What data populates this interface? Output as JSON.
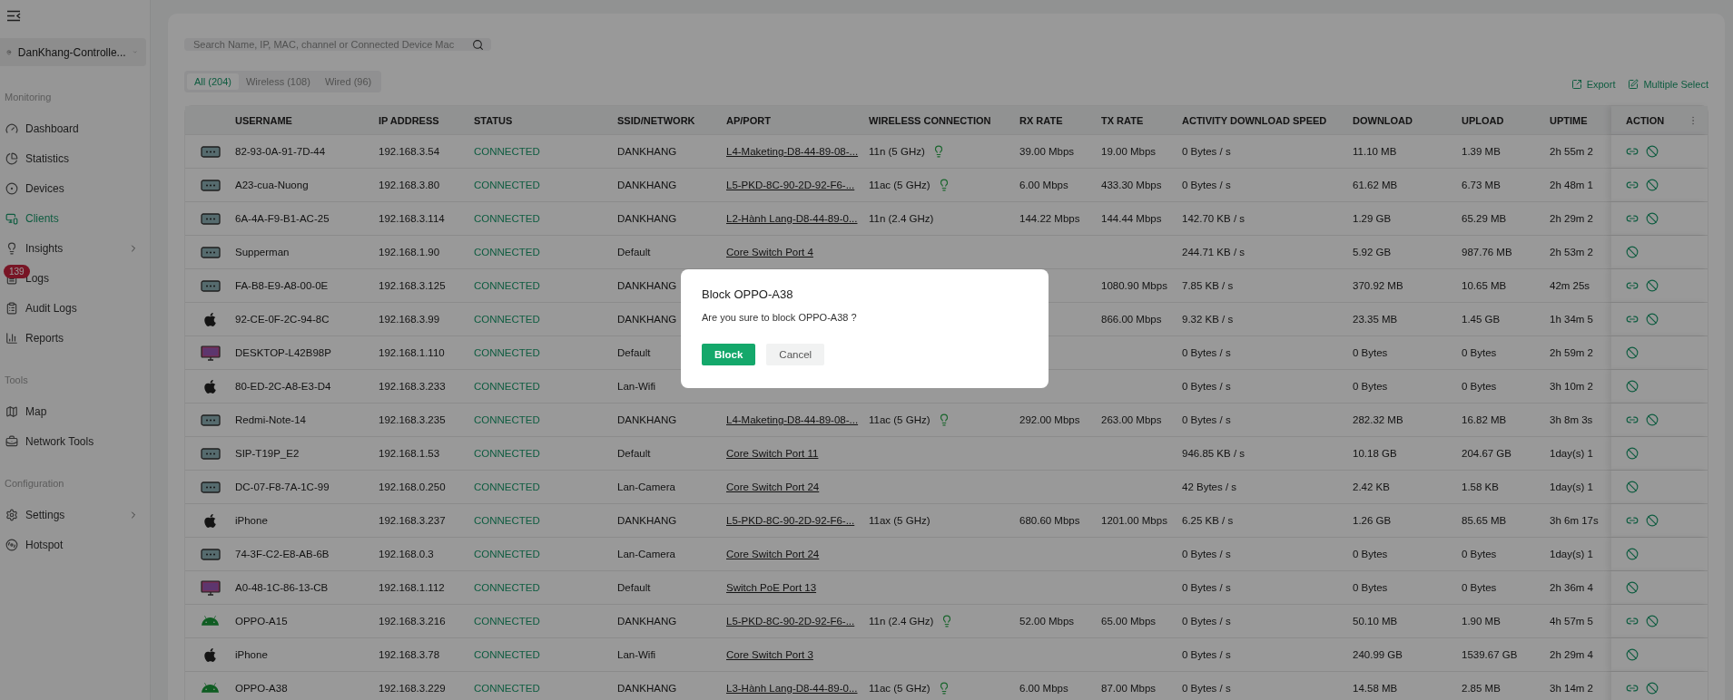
{
  "sidebar": {
    "site": "DanKhang-Controlle...",
    "sections": [
      {
        "title": "Monitoring",
        "items": [
          {
            "label": "Dashboard",
            "selected": false
          },
          {
            "label": "Statistics",
            "selected": false
          },
          {
            "label": "Devices",
            "selected": false
          },
          {
            "label": "Clients",
            "selected": true
          },
          {
            "label": "Insights",
            "selected": false,
            "submenu": true
          },
          {
            "label": "Logs",
            "selected": false,
            "badge": "139"
          },
          {
            "label": "Audit Logs",
            "selected": false
          },
          {
            "label": "Reports",
            "selected": false
          }
        ]
      },
      {
        "title": "Tools",
        "items": [
          {
            "label": "Map",
            "selected": false
          },
          {
            "label": "Network Tools",
            "selected": false
          }
        ]
      },
      {
        "title": "Configuration",
        "items": [
          {
            "label": "Settings",
            "selected": false,
            "submenu": true
          },
          {
            "label": "Hotspot",
            "selected": false
          }
        ]
      }
    ]
  },
  "search": {
    "placeholder": "Search Name, IP, MAC, channel or Connected Device Mac"
  },
  "tabs": [
    {
      "label": "All (204)",
      "selected": true
    },
    {
      "label": "Wireless (108)",
      "selected": false
    },
    {
      "label": "Wired (96)",
      "selected": false
    }
  ],
  "toolbar": [
    "Export",
    "Multiple Select"
  ],
  "table": {
    "columns": [
      "USERNAME",
      "IP ADDRESS",
      "STATUS",
      "SSID/NETWORK",
      "AP/PORT",
      "WIRELESS CONNECTION",
      "RX RATE",
      "TX RATE",
      "ACTIVITY DOWNLOAD SPEED",
      "DOWNLOAD",
      "UPLOAD",
      "UPTIME",
      "ACTION"
    ],
    "rows": [
      {
        "kind": "generic",
        "username": "82-93-0A-91-7D-44",
        "ip": "192.168.3.54",
        "status": "CONNECTED",
        "ssid": "DANKHANG",
        "ap_port": "L4-Maketing-D8-44-89-08-...",
        "wireless": "11n (5 GHz)",
        "bulb": true,
        "rx": "39.00 Mbps",
        "tx": "19.00 Mbps",
        "activity": "0 Bytes / s",
        "download": "11.10 MB",
        "upload": "1.39 MB",
        "uptime": "2h 55m 2",
        "linkable": true
      },
      {
        "kind": "generic",
        "username": "A23-cua-Nuong",
        "ip": "192.168.3.80",
        "status": "CONNECTED",
        "ssid": "DANKHANG",
        "ap_port": "L5-PKD-8C-90-2D-92-F6-...",
        "wireless": "11ac (5 GHz)",
        "bulb": true,
        "rx": "6.00 Mbps",
        "tx": "433.30 Mbps",
        "activity": "0 Bytes / s",
        "download": "61.62 MB",
        "upload": "6.73 MB",
        "uptime": "2h 48m 1",
        "linkable": true
      },
      {
        "kind": "generic",
        "username": "6A-4A-F9-B1-AC-25",
        "ip": "192.168.3.114",
        "status": "CONNECTED",
        "ssid": "DANKHANG",
        "ap_port": "L2-Hành Lang-D8-44-89-0...",
        "wireless": "11n (2.4 GHz)",
        "bulb": false,
        "rx": "144.22 Mbps",
        "tx": "144.44 Mbps",
        "activity": "142.70 KB / s",
        "download": "1.29 GB",
        "upload": "65.29 MB",
        "uptime": "2h 29m 2",
        "linkable": true
      },
      {
        "kind": "generic",
        "username": "Supperman",
        "ip": "192.168.1.90",
        "status": "CONNECTED",
        "ssid": "Default",
        "ap_port": "Core Switch Port 4",
        "activity": "244.71 KB / s",
        "download": "5.92 GB",
        "upload": "987.76 MB",
        "uptime": "2h 53m 2",
        "linkable": false
      },
      {
        "kind": "generic",
        "username": "FA-B8-E9-A8-00-0E",
        "ip": "192.168.3.125",
        "status": "CONNECTED",
        "ssid": "DANKHANG",
        "tx": "1080.90 Mbps",
        "activity": "7.85 KB / s",
        "download": "370.92 MB",
        "upload": "10.65 MB",
        "uptime": "42m 25s",
        "linkable": true
      },
      {
        "kind": "apple",
        "username": "92-CE-0F-2C-94-8C",
        "ip": "192.168.3.99",
        "status": "CONNECTED",
        "ssid": "DANKHANG",
        "tx": "866.00 Mbps",
        "activity": "9.32 KB / s",
        "download": "23.35 MB",
        "upload": "1.45 GB",
        "uptime": "1h 34m 5",
        "linkable": true
      },
      {
        "kind": "desktop",
        "username": "DESKTOP-L42B98P",
        "ip": "192.168.1.110",
        "status": "CONNECTED",
        "ssid": "Default",
        "activity": "0 Bytes / s",
        "download": "0 Bytes",
        "upload": "0 Bytes",
        "uptime": "2h 59m 2",
        "linkable": false
      },
      {
        "kind": "apple",
        "username": "80-ED-2C-A8-E3-D4",
        "ip": "192.168.3.233",
        "status": "CONNECTED",
        "ssid": "Lan-Wifi",
        "activity": "0 Bytes / s",
        "download": "0 Bytes",
        "upload": "0 Bytes",
        "uptime": "3h 10m 2",
        "linkable": false
      },
      {
        "kind": "generic",
        "username": "Redmi-Note-14",
        "ip": "192.168.3.235",
        "status": "CONNECTED",
        "ssid": "DANKHANG",
        "ap_port": "L4-Maketing-D8-44-89-08-...",
        "wireless": "11ac (5 GHz)",
        "bulb": true,
        "rx": "292.00 Mbps",
        "tx": "263.00 Mbps",
        "activity": "0 Bytes / s",
        "download": "282.32 MB",
        "upload": "16.82 MB",
        "uptime": "3h 8m 3s",
        "linkable": true
      },
      {
        "kind": "generic",
        "username": "SIP-T19P_E2",
        "ip": "192.168.1.53",
        "status": "CONNECTED",
        "ssid": "Default",
        "ap_port": "Core Switch Port 11",
        "activity": "946.85 KB / s",
        "download": "10.18 GB",
        "upload": "204.67 GB",
        "uptime": "1day(s) 1",
        "linkable": false
      },
      {
        "kind": "generic",
        "username": "DC-07-F8-7A-1C-99",
        "ip": "192.168.0.250",
        "status": "CONNECTED",
        "ssid": "Lan-Camera",
        "ap_port": "Core Switch Port 24",
        "activity": "42 Bytes / s",
        "download": "2.42 KB",
        "upload": "1.58 KB",
        "uptime": "1day(s) 1",
        "linkable": false
      },
      {
        "kind": "apple",
        "username": "iPhone",
        "ip": "192.168.3.237",
        "status": "CONNECTED",
        "ssid": "DANKHANG",
        "ap_port": "L5-PKD-8C-90-2D-92-F6-...",
        "wireless": "11ax (5 GHz)",
        "bulb": false,
        "rx": "680.60 Mbps",
        "tx": "1201.00 Mbps",
        "activity": "6.25 KB / s",
        "download": "1.26 GB",
        "upload": "85.65 MB",
        "uptime": "3h 6m 17s",
        "linkable": true
      },
      {
        "kind": "generic",
        "username": "74-3F-C2-E8-AB-6B",
        "ip": "192.168.0.3",
        "status": "CONNECTED",
        "ssid": "Lan-Camera",
        "ap_port": "Core Switch Port 24",
        "activity": "0 Bytes / s",
        "download": "0 Bytes",
        "upload": "0 Bytes",
        "uptime": "1day(s) 1",
        "linkable": false
      },
      {
        "kind": "desktop",
        "username": "A0-48-1C-86-13-CB",
        "ip": "192.168.1.112",
        "status": "CONNECTED",
        "ssid": "Default",
        "ap_port": "Switch PoE Port 13",
        "activity": "0 Bytes / s",
        "download": "0 Bytes",
        "upload": "0 Bytes",
        "uptime": "2h 36m 4",
        "linkable": false
      },
      {
        "kind": "android",
        "username": "OPPO-A15",
        "ip": "192.168.3.216",
        "status": "CONNECTED",
        "ssid": "DANKHANG",
        "ap_port": "L5-PKD-8C-90-2D-92-F6-...",
        "wireless": "11n (2.4 GHz)",
        "bulb": true,
        "rx": "52.00 Mbps",
        "tx": "65.00 Mbps",
        "activity": "0 Bytes / s",
        "download": "50.10 MB",
        "upload": "1.90 MB",
        "uptime": "4h 57m 5",
        "linkable": true
      },
      {
        "kind": "apple",
        "username": "iPhone",
        "ip": "192.168.3.78",
        "status": "CONNECTED",
        "ssid": "Lan-Wifi",
        "ap_port": "Core Switch Port 3",
        "activity": "0 Bytes / s",
        "download": "240.99 GB",
        "upload": "1539.67 GB",
        "uptime": "2h 29m 4",
        "linkable": false
      },
      {
        "kind": "android",
        "username": "OPPO-A38",
        "ip": "192.168.3.229",
        "status": "CONNECTED",
        "ssid": "DANKHANG",
        "ap_port": "L3-Hành Lang-D8-44-89-0...",
        "wireless": "11ac (5 GHz)",
        "bulb": true,
        "rx": "6.00 Mbps",
        "tx": "87.00 Mbps",
        "activity": "0 Bytes / s",
        "download": "14.58 MB",
        "upload": "2.85 MB",
        "uptime": "3h 14m 2",
        "linkable": true
      }
    ]
  },
  "dialog": {
    "title": "Block OPPO-A38",
    "message": "Are you sure to block OPPO-A38 ?",
    "buttons": [
      {
        "kind": "primary",
        "label": "Block"
      },
      {
        "kind": "secondary",
        "label": "Cancel"
      }
    ]
  }
}
